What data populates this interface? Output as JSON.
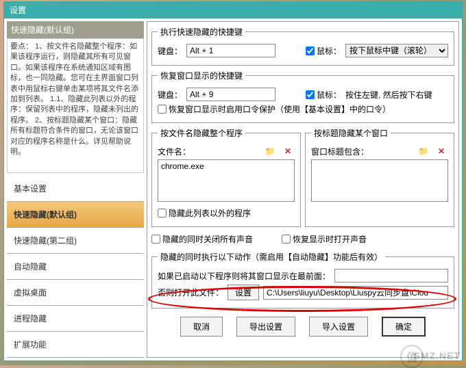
{
  "title": "设置",
  "sidebar": {
    "header": "快速隐藏(默认组)",
    "description": "要点：\n1、按文件名隐藏整个程序：如果该程序运行，则隐藏其所有可见窗口。如果该程序在系统通知区域有图标，也一同隐藏。您可在主界面窗口列表中用鼠标右键单击某项将其文件名添加到列表。\n1.1、隐藏此列表以外的程序：保留列表中的程序，隐藏未列出的程序。\n2、按标题隐藏某个窗口：隐藏所有标题符合条件的窗口，无论该窗口对应的程序名称是什么。详见帮助说明。",
    "tabs": [
      "基本设置",
      "快速隐藏(默认组)",
      "快速隐藏(第二组)",
      "自动隐藏",
      "虚拟桌面",
      "进程隐藏",
      "扩展功能"
    ]
  },
  "exec_hotkey": {
    "legend": "执行快速隐藏的快捷键",
    "kb_label": "键盘：",
    "kb_value": "Alt + 1",
    "mouse_cb": "鼠标：",
    "mouse_select": "按下鼠标中键（滚轮）"
  },
  "restore_hotkey": {
    "legend": "恢复窗口显示的快捷键",
    "kb_label": "键盘：",
    "kb_value": "Alt + 9",
    "mouse_cb": "鼠标：",
    "mouse_text": "按住左键, 然后按下右键",
    "pw_cb": "恢复窗口显示时启用口令保护（使用【基本设置】中的口令）"
  },
  "by_file": {
    "legend": "按文件名隐藏整个程序",
    "label": "文件名：",
    "item": "chrome.exe",
    "inverse_cb": "隐藏此列表以外的程序"
  },
  "by_title": {
    "legend": "按标题隐藏某个窗口",
    "label": "窗口标题包含："
  },
  "mute_cb": "隐藏的同时关闭所有声音",
  "unmute_cb": "恢复显示时打开声音",
  "actions": {
    "legend": "隐藏的同时执行以下动作（需启用【自动隐藏】功能后有效）",
    "front_label": "如果已启动以下程序则将其窗口显示在最前面：",
    "open_label": "否则打开此文件：",
    "set_btn": "设置",
    "path": "C:\\Users\\liuyu\\Desktop\\Liuspy云同步盘\\Clou"
  },
  "buttons": {
    "cancel": "取消",
    "export": "导出设置",
    "import": "导入设置",
    "ok": "确定"
  },
  "watermark": "SMZ.NET",
  "wm_glyph": "值"
}
